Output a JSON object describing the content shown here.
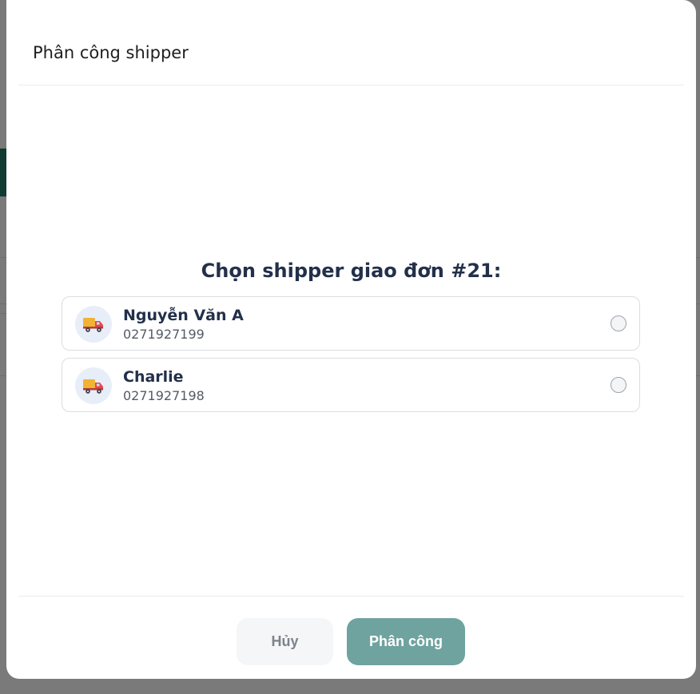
{
  "modal": {
    "title": "Phân công shipper",
    "prompt": "Chọn shipper giao đơn #21:",
    "shippers": [
      {
        "name": "Nguyễn Văn A",
        "phone": "0271927199",
        "selected": false,
        "icon": "delivery-truck-icon"
      },
      {
        "name": "Charlie",
        "phone": "0271927198",
        "selected": false,
        "icon": "delivery-truck-icon"
      }
    ],
    "cancel_label": "Hủy",
    "assign_label": "Phân công"
  },
  "colors": {
    "accent": "#6fa39f",
    "prompt_text": "#22304a",
    "overlay": "#7a7a7a",
    "background_bar": "#0f3b33"
  }
}
